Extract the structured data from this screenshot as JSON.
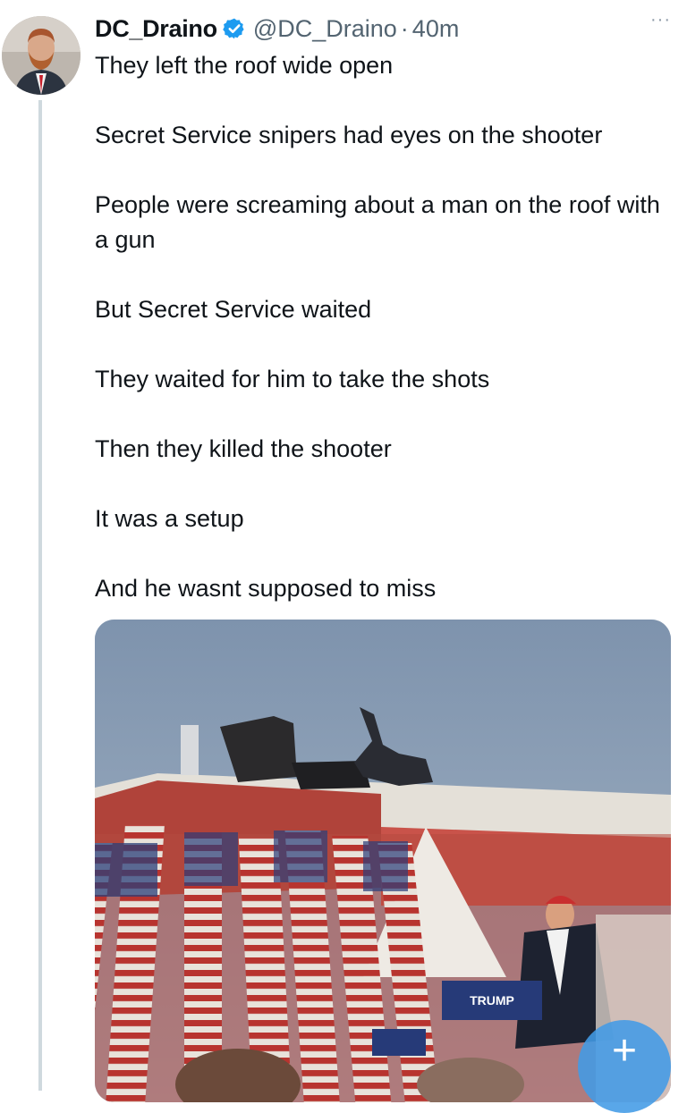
{
  "tweet": {
    "author_name": "DC_Draino",
    "handle": "@DC_Draino",
    "separator": "·",
    "time": "40m",
    "more_menu": "···",
    "verified_color": "#1d9bf0",
    "lines": [
      "They left the roof wide open",
      "Secret Service snipers had eyes on the shooter",
      "People were screaming about a man on the roof with a gun",
      "But Secret Service waited",
      "They waited for him to take the shots",
      "Then they killed the shooter",
      "It was a setup",
      "And he wasnt supposed to miss"
    ],
    "media": {
      "podium_sign": "TRUMP"
    }
  },
  "compose_fab": {
    "label": "+",
    "color": "#1d9bf0"
  }
}
